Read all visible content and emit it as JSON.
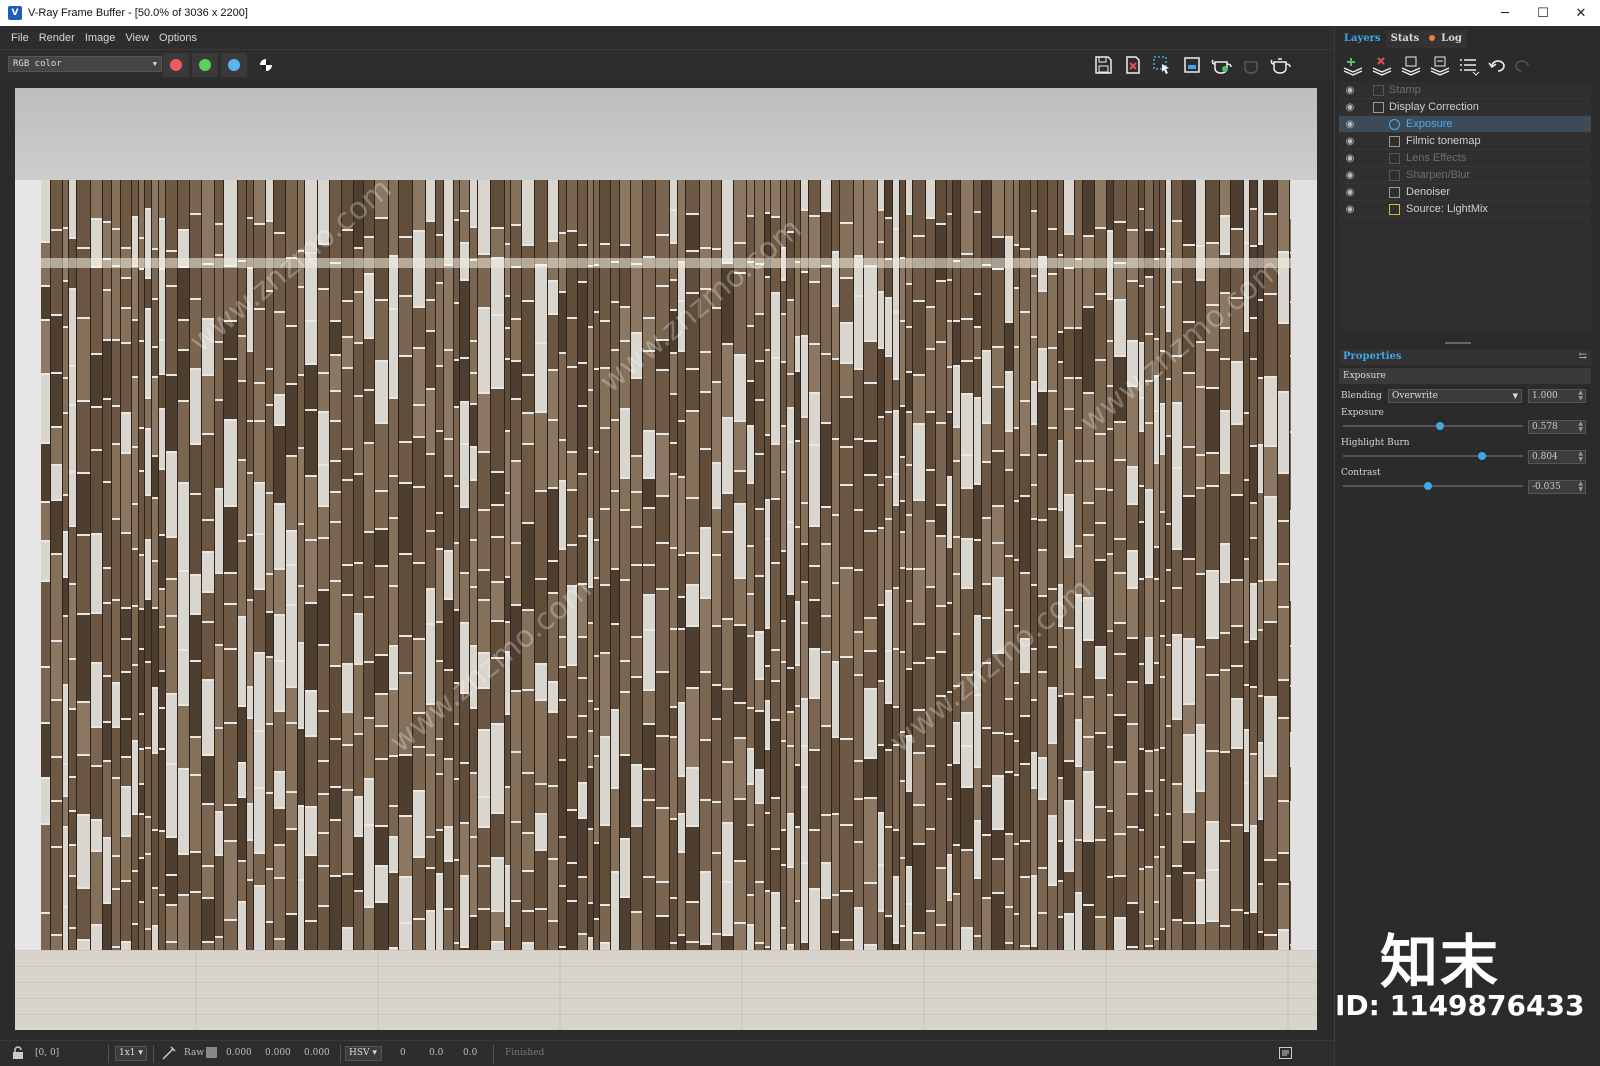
{
  "window": {
    "title": "V-Ray Frame Buffer - [50.0% of 3036 x 2200]",
    "controls": {
      "minimize": "─",
      "maximize": "☐",
      "close": "✕"
    }
  },
  "menu": [
    "File",
    "Render",
    "Image",
    "View",
    "Options"
  ],
  "toolbar": {
    "channel_select": "RGB color",
    "color_buttons": [
      {
        "name": "red-channel",
        "color": "#f05a5a"
      },
      {
        "name": "green-channel",
        "color": "#5ad25a"
      },
      {
        "name": "blue-channel",
        "color": "#5ab4f0"
      }
    ]
  },
  "right_panel": {
    "tabs": [
      "Layers",
      "Stats",
      "Log"
    ],
    "layers": [
      {
        "label": "Stamp",
        "dim": true,
        "indent": 0
      },
      {
        "label": "Display Correction",
        "dim": false,
        "indent": 0
      },
      {
        "label": "Exposure",
        "dim": false,
        "indent": 1,
        "selected": true
      },
      {
        "label": "Filmic tonemap",
        "dim": false,
        "indent": 1
      },
      {
        "label": "Lens Effects",
        "dim": true,
        "indent": 1
      },
      {
        "label": "Sharpen/Blur",
        "dim": true,
        "indent": 1
      },
      {
        "label": "Denoiser",
        "dim": false,
        "indent": 1
      },
      {
        "label": "Source: LightMix",
        "dim": false,
        "indent": 1
      }
    ],
    "properties": {
      "header": "Properties",
      "layer_name": "Exposure",
      "blending_label": "Blending",
      "blending_mode": "Overwrite",
      "blending_value": "1.000",
      "exposure_label": "Exposure",
      "exposure_value": "0.578",
      "exposure_level": 0.54,
      "highlight_label": "Highlight Burn",
      "highlight_value": "0.804",
      "highlight_level": 0.77,
      "contrast_label": "Contrast",
      "contrast_value": "-0.035",
      "contrast_level": 0.47
    }
  },
  "statusbar": {
    "coords": "[0, 0]",
    "zoom": "1x1",
    "raw_label": "Raw",
    "raw_values": [
      "0.000",
      "0.000",
      "0.000"
    ],
    "color_mode": "HSV",
    "hsv_values": [
      "0",
      "0.0",
      "0.0"
    ],
    "status": "Finished"
  },
  "watermark": {
    "brand": "知末",
    "id": "ID: 1149876433",
    "text": "www.znzmo.com"
  }
}
